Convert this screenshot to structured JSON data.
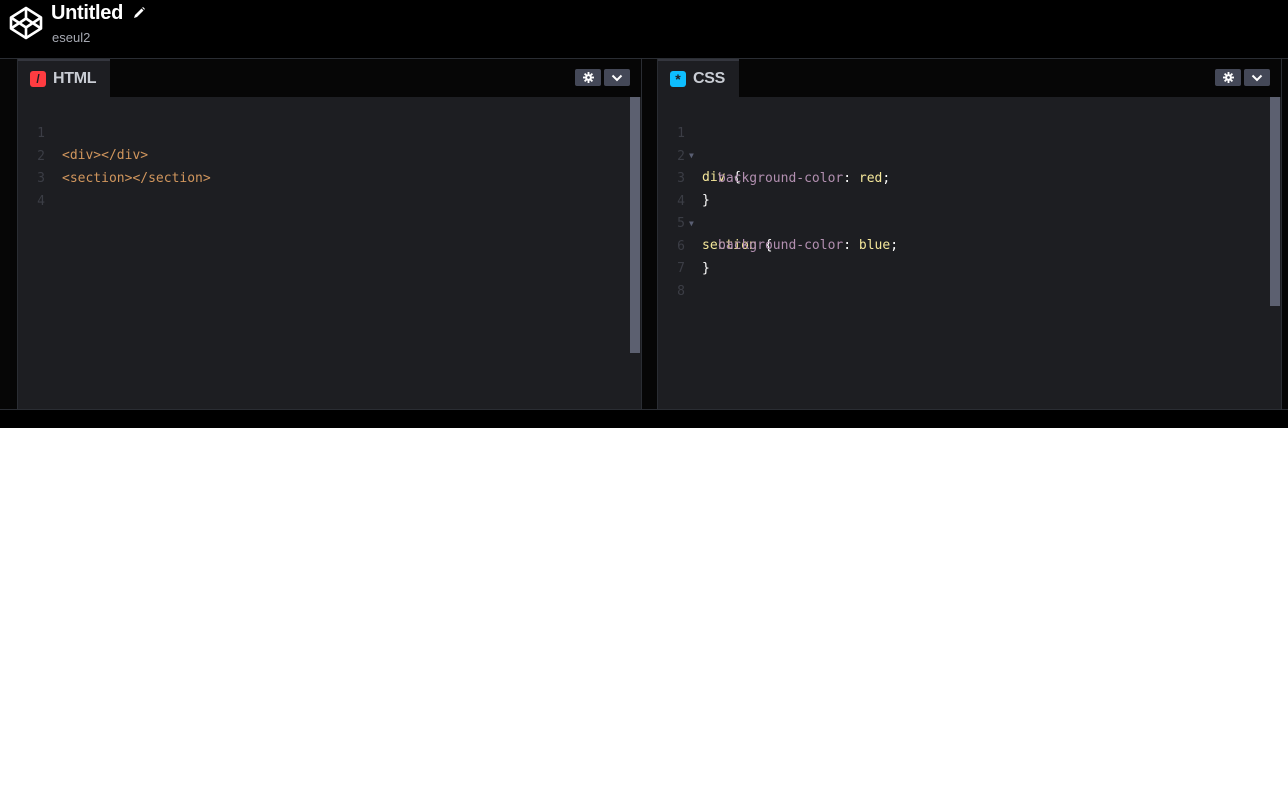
{
  "header": {
    "title": "Untitled",
    "username": "eseul2",
    "icons": {
      "logo": "codepen-logo-icon",
      "edit": "pencil-icon"
    }
  },
  "html_panel": {
    "tab_label": "HTML",
    "tab_icon_glyph": "/",
    "tab_icon_color": "#ff3c41",
    "line_numbers": [
      "1",
      "2",
      "3",
      "4"
    ],
    "lines": [
      "<div></div>",
      "<section></section>",
      "",
      ""
    ],
    "code_color": "#d1965d"
  },
  "css_panel": {
    "tab_label": "CSS",
    "tab_icon_glyph": "*",
    "tab_icon_color": "#0ebeff",
    "line_numbers": [
      "1",
      "2",
      "3",
      "4",
      "5",
      "6",
      "7",
      "8"
    ],
    "lines": [
      {
        "selector": "div",
        "brace": " {"
      },
      {
        "property": "background-color",
        "colon": ": ",
        "value": "red",
        "semi": ";"
      },
      {
        "brace": "}"
      },
      {
        "selector": "section",
        "brace": " {"
      },
      {
        "property": "background-color",
        "colon": ": ",
        "value": "blue",
        "semi": ";"
      },
      {
        "brace": "}"
      },
      {},
      {}
    ],
    "colors": {
      "selector": "#f5e79a",
      "property": "#b28fb0",
      "value": "#f5e79a",
      "punct": "#ffffff"
    }
  },
  "controls": {
    "settings_icon": "gear-icon",
    "collapse_icon": "chevron-down-icon"
  }
}
